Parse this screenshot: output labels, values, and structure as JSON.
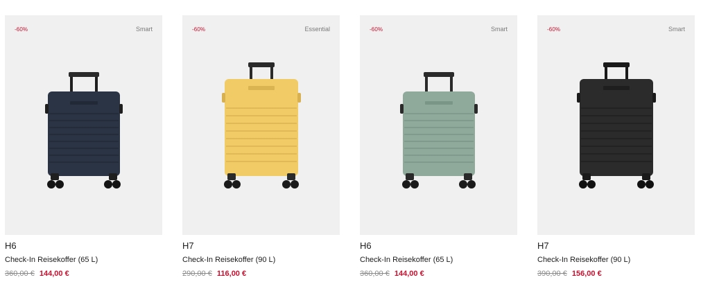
{
  "products": [
    {
      "discount": "-60%",
      "tag": "Smart",
      "model": "H6",
      "description": "Check-In Reisekoffer (65 L)",
      "old_price": "360,00 €",
      "new_price": "144,00 €",
      "color": "#2a3444"
    },
    {
      "discount": "-60%",
      "tag": "Essential",
      "model": "H7",
      "description": "Check-In Reisekoffer (90 L)",
      "old_price": "290,00 €",
      "new_price": "116,00 €",
      "color": "#f1cb66"
    },
    {
      "discount": "-60%",
      "tag": "Smart",
      "model": "H6",
      "description": "Check-In Reisekoffer (65 L)",
      "old_price": "360,00 €",
      "new_price": "144,00 €",
      "color": "#8faa9b"
    },
    {
      "discount": "-60%",
      "tag": "Smart",
      "model": "H7",
      "description": "Check-In Reisekoffer (90 L)",
      "old_price": "390,00 €",
      "new_price": "156,00 €",
      "color": "#2b2b2b"
    }
  ],
  "colors": {
    "sale_red": "#c8102e",
    "tile_bg": "#f0f0f0",
    "strike_grey": "#8a8a8a"
  }
}
